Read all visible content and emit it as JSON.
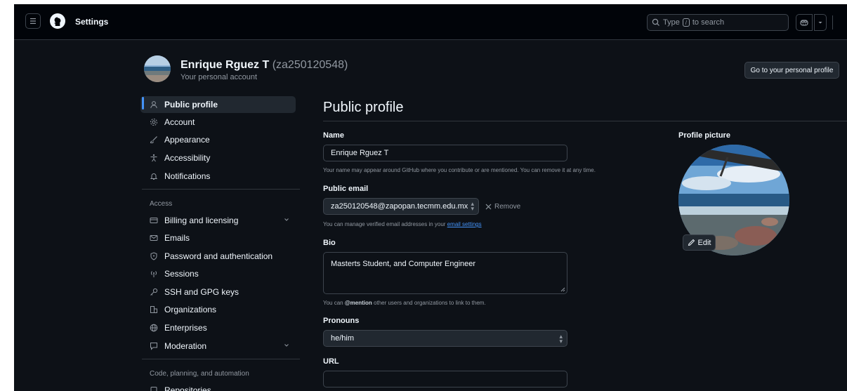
{
  "header": {
    "title": "Settings",
    "search_placeholder_pre": "Type",
    "search_kbd": "/",
    "search_placeholder_post": "to search"
  },
  "account": {
    "name": "Enrique Rguez T",
    "handle": "(za250120548)",
    "subtitle": "Your personal account",
    "profile_button": "Go to your personal profile"
  },
  "sidebar": {
    "items": [
      {
        "label": "Public profile",
        "icon": "person-icon"
      },
      {
        "label": "Account",
        "icon": "gear-icon"
      },
      {
        "label": "Appearance",
        "icon": "paintbrush-icon"
      },
      {
        "label": "Accessibility",
        "icon": "accessibility-icon"
      },
      {
        "label": "Notifications",
        "icon": "bell-icon"
      }
    ],
    "access_heading": "Access",
    "access_items": [
      {
        "label": "Billing and licensing",
        "icon": "credit-card-icon"
      },
      {
        "label": "Emails",
        "icon": "mail-icon"
      },
      {
        "label": "Password and authentication",
        "icon": "shield-icon"
      },
      {
        "label": "Sessions",
        "icon": "broadcast-icon"
      },
      {
        "label": "SSH and GPG keys",
        "icon": "key-icon"
      },
      {
        "label": "Organizations",
        "icon": "organization-icon"
      },
      {
        "label": "Enterprises",
        "icon": "globe-icon"
      },
      {
        "label": "Moderation",
        "icon": "report-icon"
      }
    ],
    "code_heading": "Code, planning, and automation",
    "code_items": [
      {
        "label": "Repositories",
        "icon": "repo-icon"
      }
    ]
  },
  "main": {
    "title": "Public profile",
    "name_label": "Name",
    "name_value": "Enrique Rguez T",
    "name_hint": "Your name may appear around GitHub where you contribute or are mentioned. You can remove it at any time.",
    "email_label": "Public email",
    "email_value": "za250120548@zapopan.tecmm.edu.mx",
    "remove_label": "Remove",
    "email_hint_pre": "You can manage verified email addresses in your",
    "email_hint_link": "email settings",
    "bio_label": "Bio",
    "bio_value": "Masterts Student, and Computer Engineer",
    "bio_hint_pre": "You can",
    "bio_hint_mention": "@mention",
    "bio_hint_post": "other users and organizations to link to them.",
    "pronouns_label": "Pronouns",
    "pronouns_value": "he/him",
    "url_label": "URL",
    "url_value": "",
    "picture_label": "Profile picture",
    "edit_label": "Edit"
  }
}
